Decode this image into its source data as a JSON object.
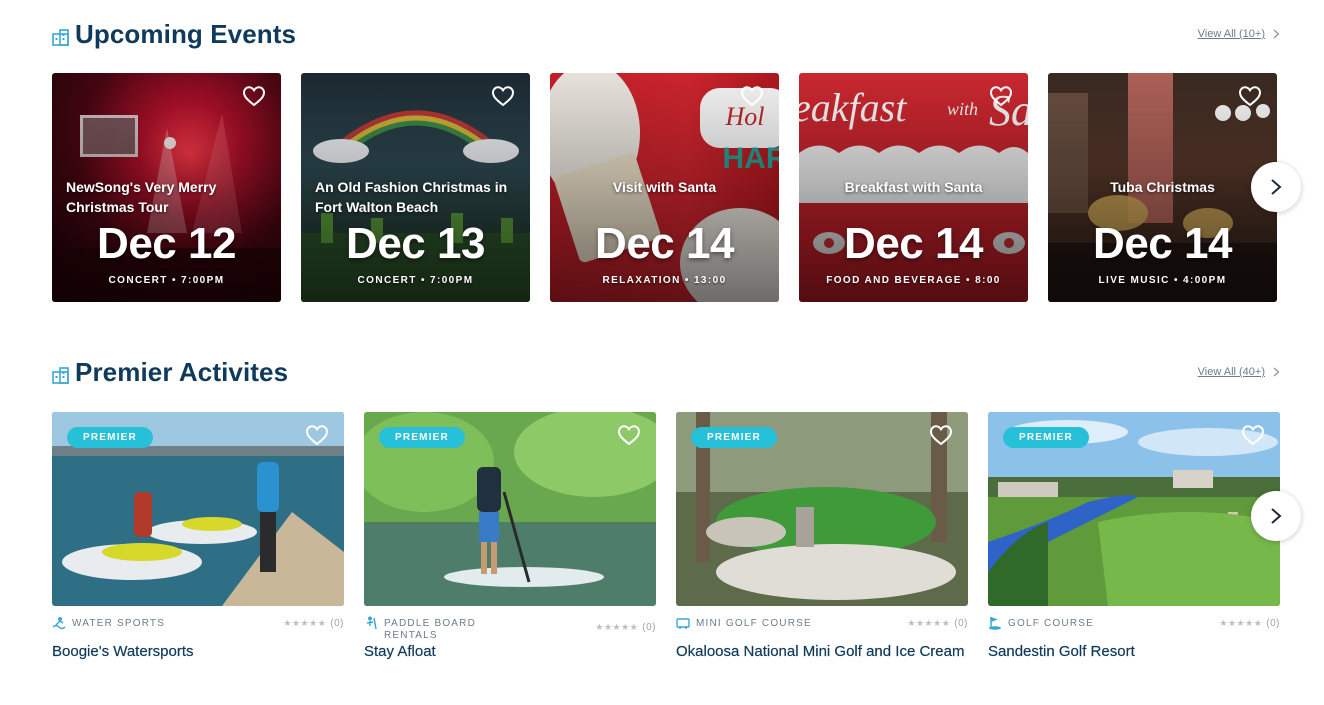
{
  "events_section": {
    "title": "Upcoming Events",
    "view_all": "View All (10+)"
  },
  "events": [
    {
      "name": "NewSong's Very Merry Christmas Tour",
      "date": "Dec 12",
      "meta": "CONCERT • 7:00PM"
    },
    {
      "name": "An Old Fashion Christmas in Fort Walton Beach",
      "date": "Dec 13",
      "meta": "CONCERT • 7:00PM"
    },
    {
      "name": "Visit with Santa",
      "date": "Dec 14",
      "meta": "RELAXATION • 13:00"
    },
    {
      "name": "Breakfast with Santa",
      "date": "Dec 14",
      "meta": "FOOD AND BEVERAGE • 8:00"
    },
    {
      "name": "Tuba Christmas",
      "date": "Dec 14",
      "meta": "LIVE MUSIC • 4:00PM"
    }
  ],
  "activities_section": {
    "title": "Premier Activites",
    "view_all": "View All (40+)"
  },
  "activities": [
    {
      "badge": "PREMIER",
      "category": "WATER SPORTS",
      "rating": "(0)",
      "name": "Boogie's Watersports"
    },
    {
      "badge": "PREMIER",
      "category": "PADDLE BOARD RENTALS",
      "rating": "(0)",
      "name": "Stay Afloat"
    },
    {
      "badge": "PREMIER",
      "category": "MINI GOLF COURSE",
      "rating": "(0)",
      "name": "Okaloosa National Mini Golf and Ice Cream"
    },
    {
      "badge": "PREMIER",
      "category": "GOLF COURSE",
      "rating": "(0)",
      "name": "Sandestin Golf Resort"
    }
  ],
  "stars": "★★★★★",
  "colors": {
    "title": "#0f3a5b",
    "badge": "#26c0d8",
    "muted": "#6b7d8c"
  },
  "icons": {
    "section": "building-icon",
    "favorite": "heart-outline-icon",
    "next": "chevron-right-icon"
  }
}
